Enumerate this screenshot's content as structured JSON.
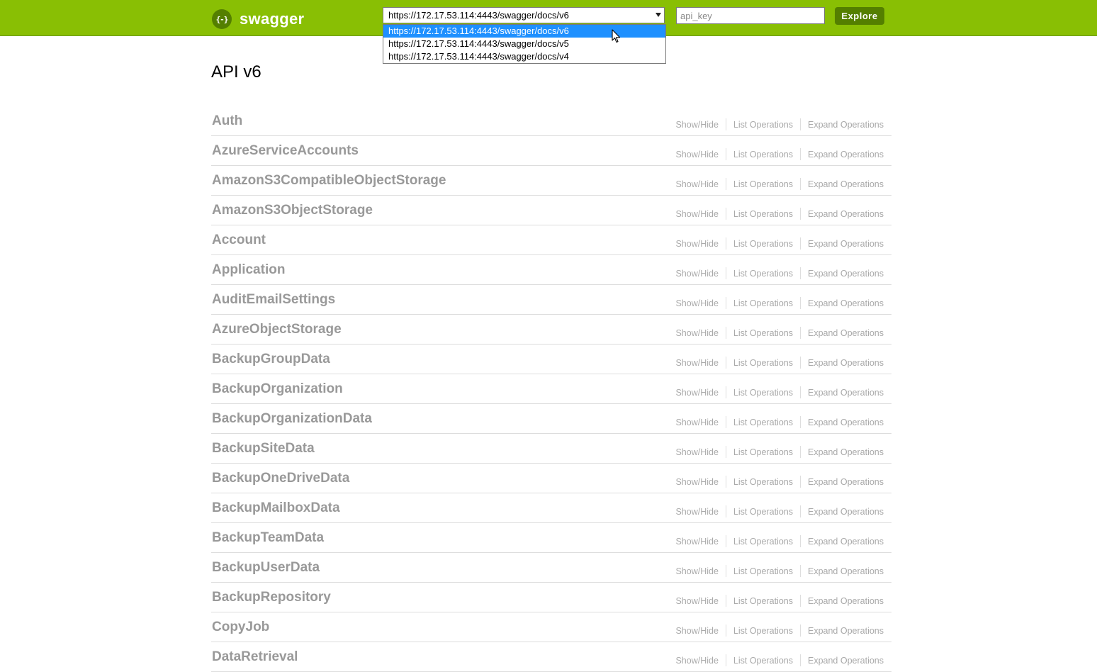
{
  "header": {
    "logo_icon_text": "{-}",
    "logo_text": "swagger",
    "url_select_value": "https://172.17.53.114:4443/swagger/docs/v6",
    "url_options": [
      "https://172.17.53.114:4443/swagger/docs/v6",
      "https://172.17.53.114:4443/swagger/docs/v5",
      "https://172.17.53.114:4443/swagger/docs/v4"
    ],
    "api_key_placeholder": "api_key",
    "api_key_value": "",
    "explore_label": "Explore",
    "colors": {
      "bar": "#89bf04",
      "button": "#547f00",
      "selected_option": "#1e90ff"
    }
  },
  "main": {
    "title": "API v6",
    "operation_links": {
      "show_hide": "Show/Hide",
      "list_operations": "List Operations",
      "expand_operations": "Expand Operations"
    },
    "resources": [
      "Auth",
      "AzureServiceAccounts",
      "AmazonS3CompatibleObjectStorage",
      "AmazonS3ObjectStorage",
      "Account",
      "Application",
      "AuditEmailSettings",
      "AzureObjectStorage",
      "BackupGroupData",
      "BackupOrganization",
      "BackupOrganizationData",
      "BackupSiteData",
      "BackupOneDriveData",
      "BackupMailboxData",
      "BackupTeamData",
      "BackupUserData",
      "BackupRepository",
      "CopyJob",
      "DataRetrieval"
    ]
  }
}
